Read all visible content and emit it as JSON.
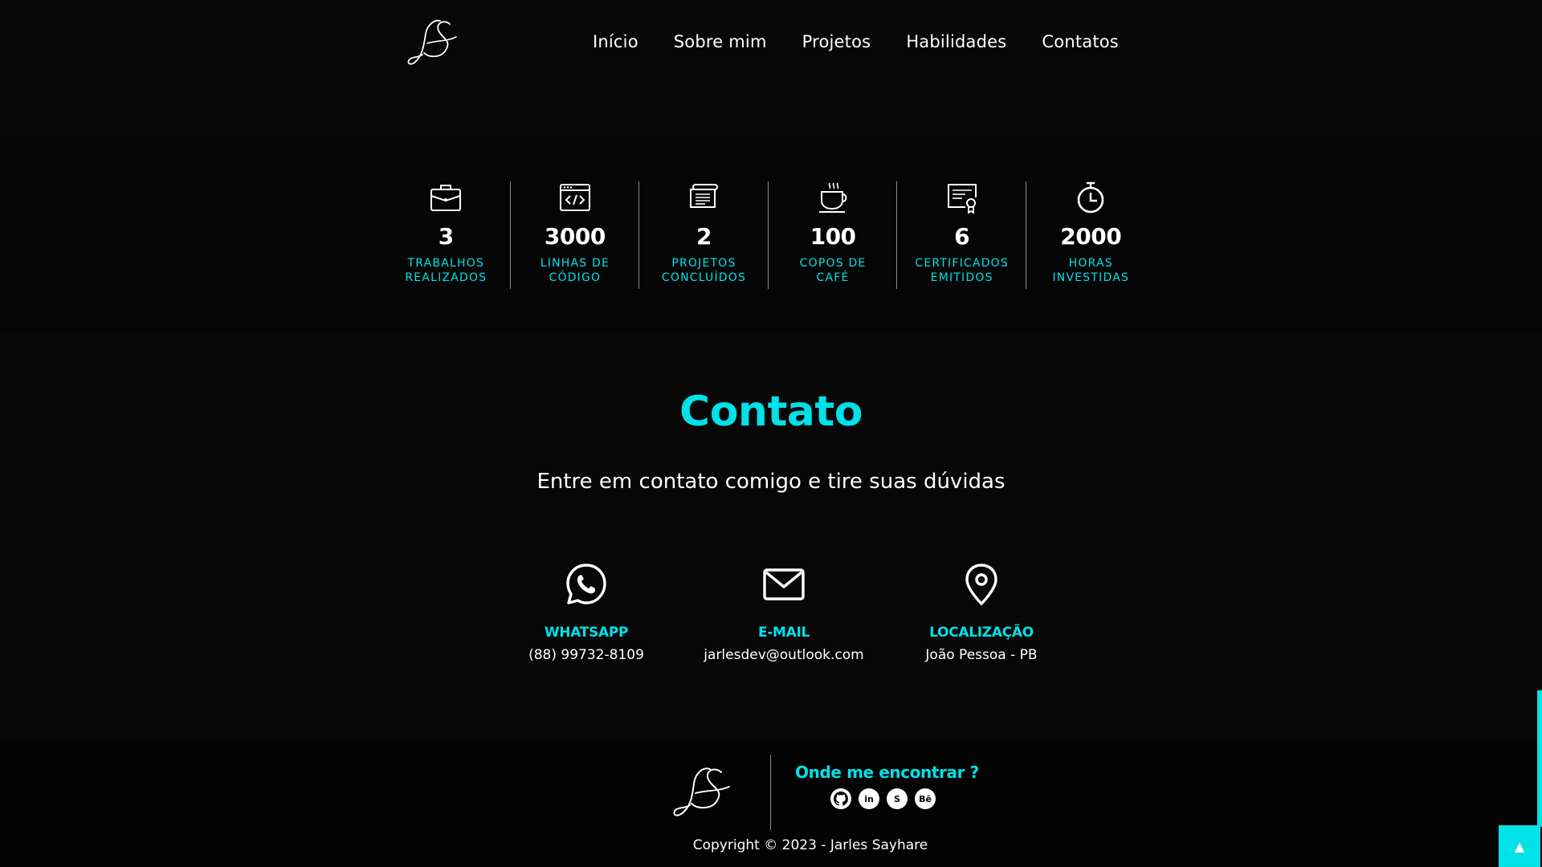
{
  "brand": {
    "logo_text": "JS"
  },
  "nav": {
    "items": [
      {
        "label": "Início"
      },
      {
        "label": "Sobre mim"
      },
      {
        "label": "Projetos"
      },
      {
        "label": "Habilidades"
      },
      {
        "label": "Contatos"
      }
    ]
  },
  "stats": [
    {
      "icon": "briefcase-icon",
      "value": "3",
      "label": "Trabalhos Realizados"
    },
    {
      "icon": "code-window-icon",
      "value": "3000",
      "label": "Linhas de Código"
    },
    {
      "icon": "certificate-scroll-icon",
      "value": "2",
      "label": "Projetos Concluídos"
    },
    {
      "icon": "coffee-cup-icon",
      "value": "100",
      "label": "Copos de Café"
    },
    {
      "icon": "certificate-badge-icon",
      "value": "6",
      "label": "Certificados Emitidos"
    },
    {
      "icon": "stopwatch-icon",
      "value": "2000",
      "label": "Horas Investidas"
    }
  ],
  "contact": {
    "title": "Contato",
    "subtitle": "Entre em contato comigo e tire suas dúvidas",
    "items": [
      {
        "icon": "whatsapp-icon",
        "title": "WHATSAPP",
        "value": "(88) 99732-8109"
      },
      {
        "icon": "mail-icon",
        "title": "E-MAIL",
        "value": "jarlesdev@outlook.com"
      },
      {
        "icon": "location-pin-icon",
        "title": "LOCALIZAÇÃO",
        "value": "João Pessoa - PB"
      }
    ]
  },
  "footer": {
    "find_title": "Onde me encontrar ?",
    "socials": [
      {
        "icon": "github-icon",
        "glyph": ""
      },
      {
        "icon": "linkedin-icon",
        "glyph": "in"
      },
      {
        "icon": "skype-icon",
        "glyph": "S"
      },
      {
        "icon": "behance-icon",
        "glyph": "Bē"
      }
    ],
    "copyright": "Copyright © 2023 - Jarles Sayhare"
  },
  "scroll_top": {
    "glyph": "▲"
  },
  "colors": {
    "accent": "#00e1e8",
    "background": "#070707",
    "text": "#ffffff"
  }
}
